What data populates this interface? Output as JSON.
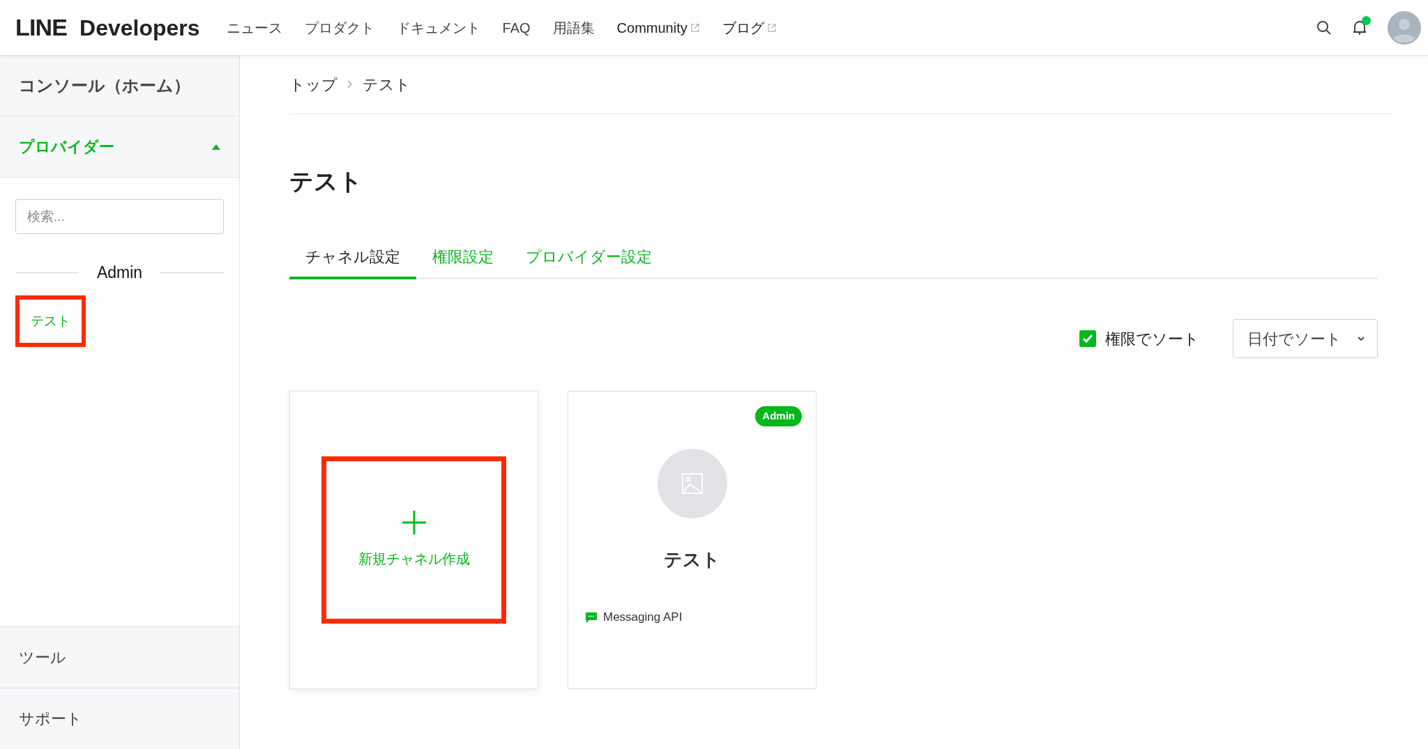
{
  "header": {
    "logo_bold": "LINE",
    "logo_text": "Developers",
    "nav": [
      {
        "label": "ニュース",
        "external": false
      },
      {
        "label": "プロダクト",
        "external": false
      },
      {
        "label": "ドキュメント",
        "external": false
      },
      {
        "label": "FAQ",
        "external": false
      },
      {
        "label": "用語集",
        "external": false
      },
      {
        "label": "Community",
        "external": true
      },
      {
        "label": "ブログ",
        "external": true
      }
    ],
    "notification_dot": true
  },
  "sidebar": {
    "home": "コンソール（ホーム）",
    "providers": {
      "label": "プロバイダー",
      "expanded": true,
      "search": {
        "placeholder": "検索..."
      },
      "group": "Admin",
      "items": [
        {
          "label": "テスト",
          "highlighted": true
        }
      ]
    },
    "bottom": [
      "ツール",
      "サポート"
    ]
  },
  "breadcrumb": [
    "トップ",
    "テスト"
  ],
  "title": "テスト",
  "tabs": [
    {
      "label": "チャネル設定",
      "selected": true
    },
    {
      "label": "権限設定",
      "selected": false
    },
    {
      "label": "プロバイダー設定",
      "selected": false
    }
  ],
  "sort": {
    "checkbox": {
      "label": "権限でソート",
      "checked": true
    },
    "select": {
      "value": "日付でソート"
    }
  },
  "cards": [
    {
      "kind": "create",
      "label": "新規チャネル作成",
      "highlighted": true
    },
    {
      "kind": "channel",
      "name": "テスト",
      "badge": "Admin",
      "type": "Messaging API"
    }
  ]
}
